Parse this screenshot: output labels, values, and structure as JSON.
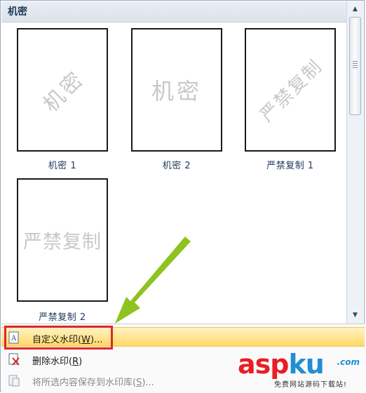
{
  "gallery": {
    "section_title": "机密",
    "items": [
      {
        "label": "机密 1",
        "watermark": "机密"
      },
      {
        "label": "机密 2",
        "watermark": "机密"
      },
      {
        "label": "严禁复制 1",
        "watermark": "严禁复制"
      },
      {
        "label": "严禁复制 2",
        "watermark": "严禁复制"
      }
    ]
  },
  "menu": {
    "custom": {
      "text": "自定义水印(",
      "key": "W",
      "suffix": ")..."
    },
    "remove": {
      "text": "删除水印(",
      "key": "R",
      "suffix": ")"
    },
    "save": {
      "text": "将所选内容保存到水印库(",
      "key": "S",
      "suffix": ")..."
    }
  },
  "logo": {
    "part1": "asp",
    "part2": "ku",
    "com": ".com",
    "tagline": "免费网站源码下载站!"
  },
  "colors": {
    "highlight": "#ffd866",
    "callout_border": "#e0262a",
    "arrow": "#8fc31f"
  }
}
